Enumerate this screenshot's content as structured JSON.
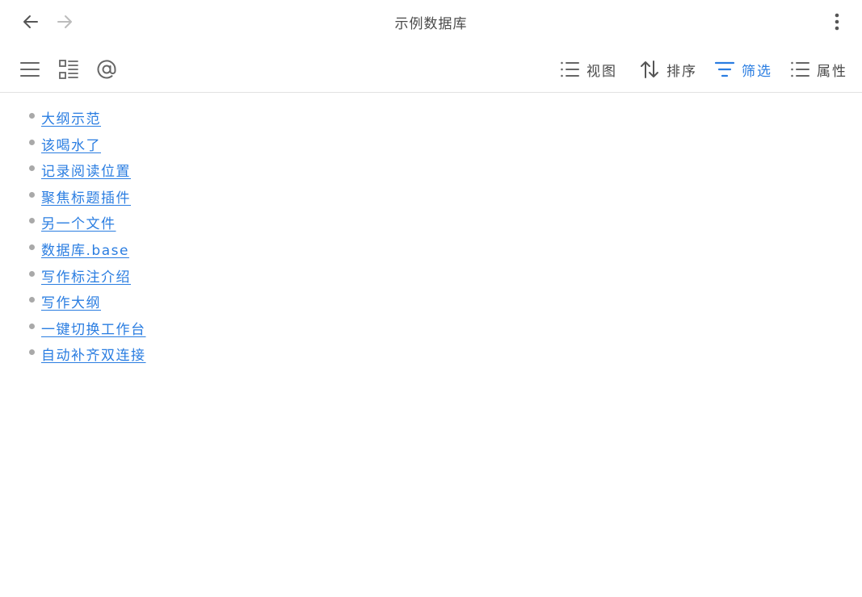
{
  "window": {
    "title": "示例数据库"
  },
  "nav": {
    "back_icon": "arrow-left-icon",
    "forward_icon": "arrow-right-icon",
    "more_icon": "more-vertical-icon"
  },
  "toolbar": {
    "left_icons": [
      "menu-icon",
      "outline-icon",
      "at-icon"
    ],
    "view_label": "视图",
    "sort_label": "排序",
    "filter_label": "筛选",
    "props_label": "属性",
    "active_color": "#2a7de1",
    "text_color": "#4a4a4a"
  },
  "list": {
    "items": [
      {
        "label": "大纲示范"
      },
      {
        "label": "该喝水了"
      },
      {
        "label": "记录阅读位置"
      },
      {
        "label": "聚焦标题插件"
      },
      {
        "label": "另一个文件"
      },
      {
        "label": "数据库.base"
      },
      {
        "label": "写作标注介绍"
      },
      {
        "label": "写作大纲"
      },
      {
        "label": "一键切换工作台"
      },
      {
        "label": "自动补齐双连接"
      }
    ],
    "link_color": "#2a7de1",
    "bullet_color": "#a9a9a9"
  }
}
